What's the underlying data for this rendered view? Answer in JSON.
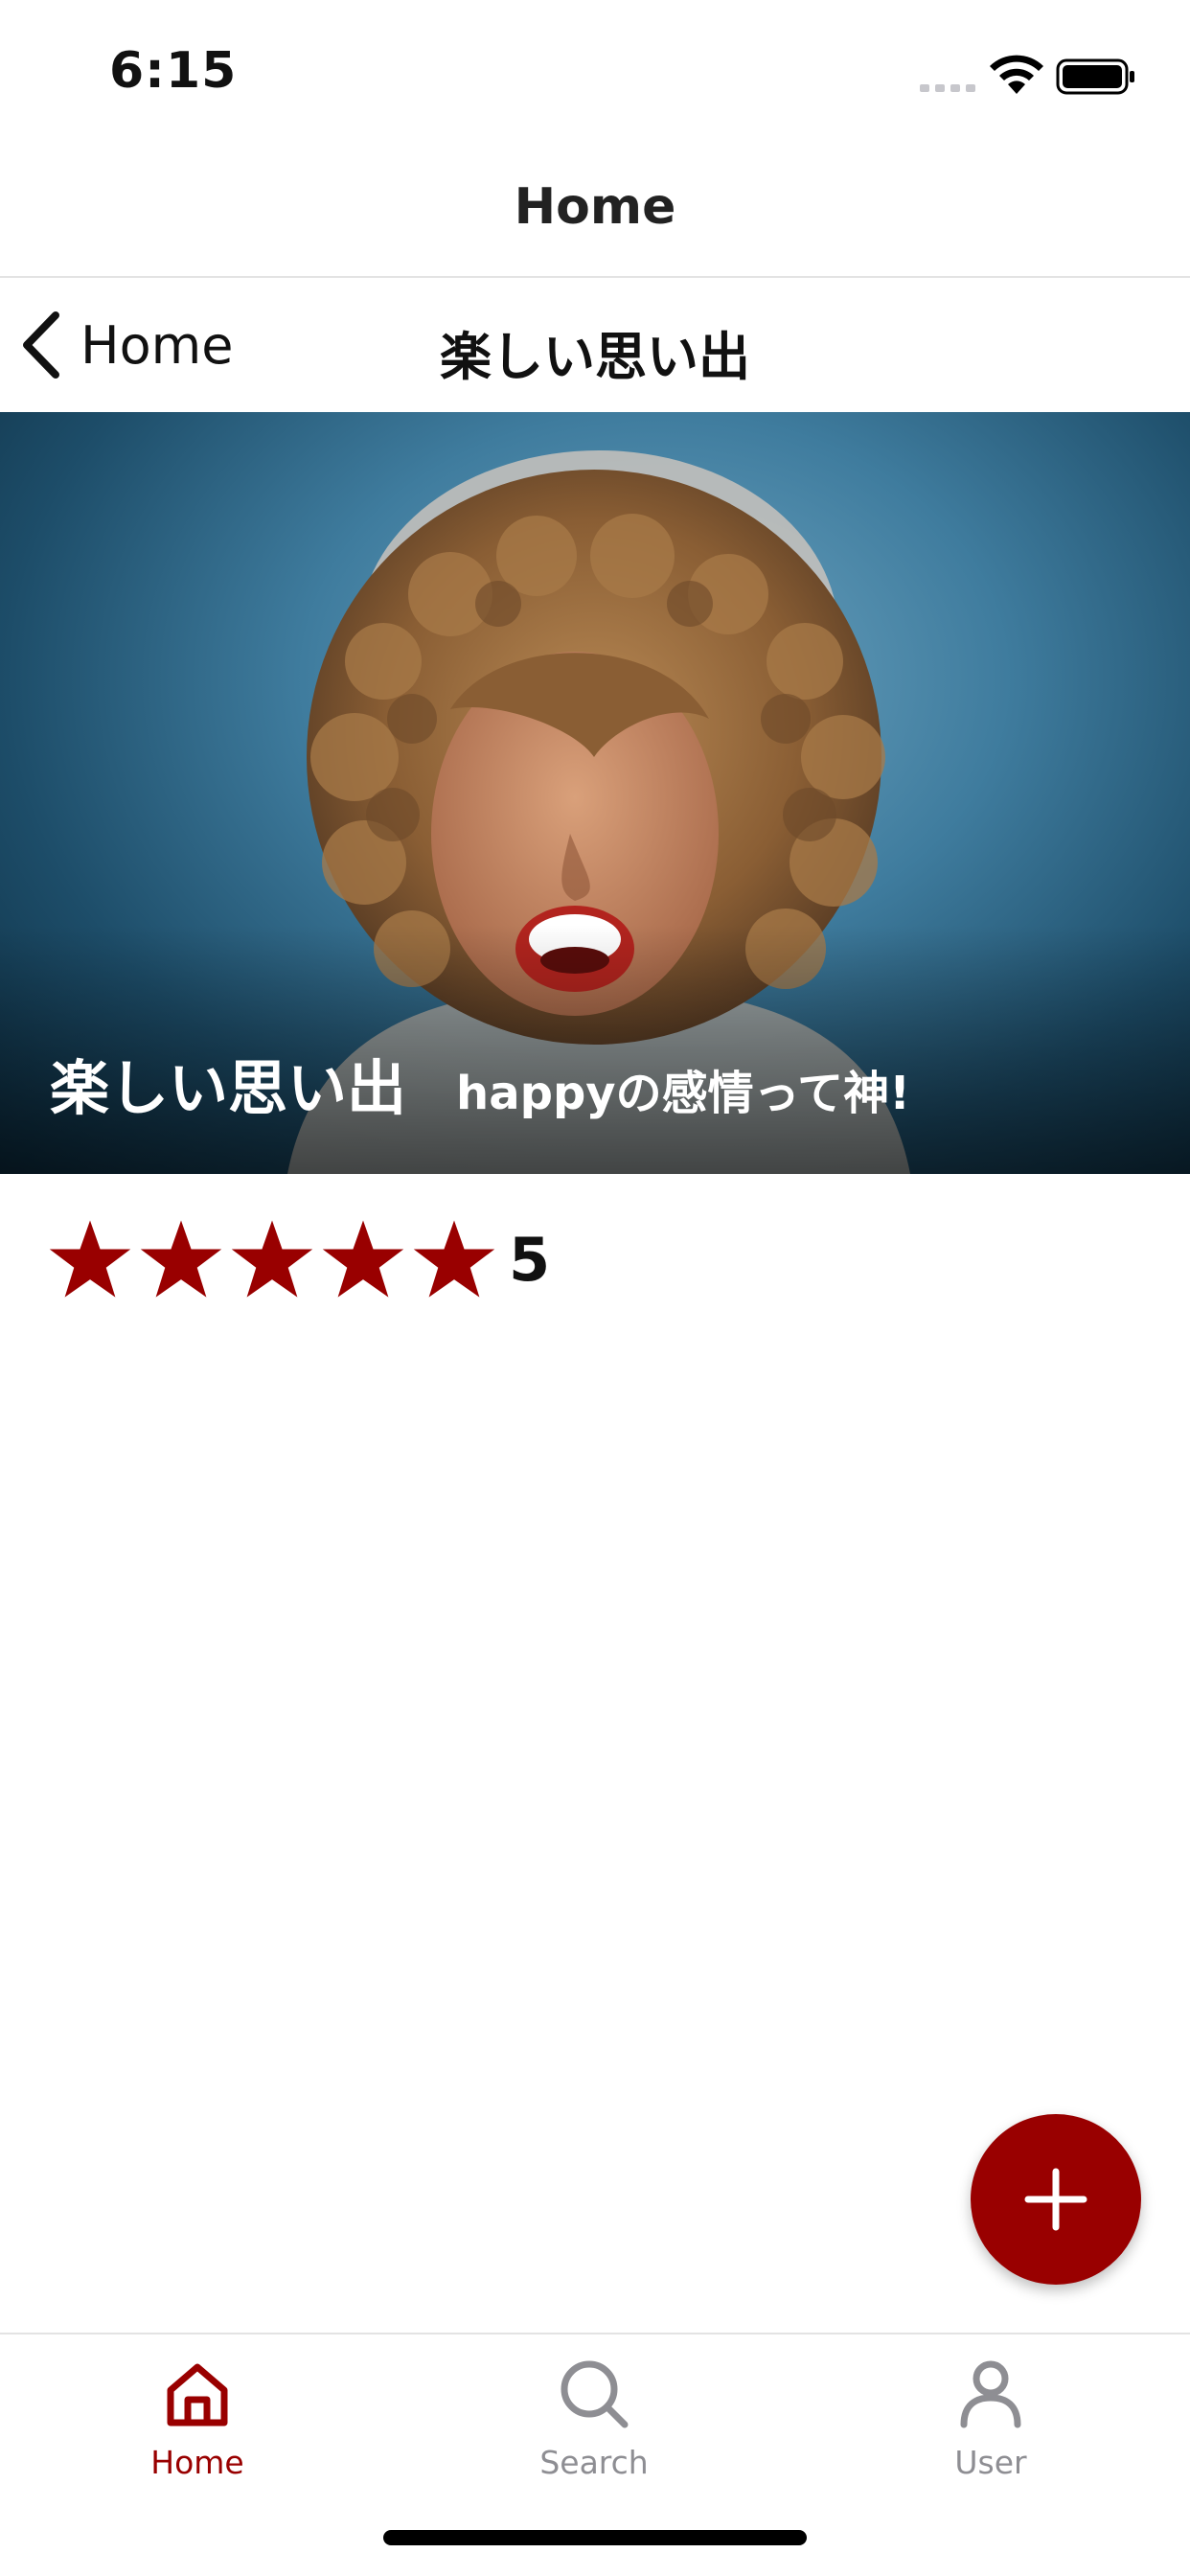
{
  "status_bar": {
    "time": "6:15",
    "icons": [
      "cellular-signal-icon",
      "wifi-icon",
      "battery-icon"
    ]
  },
  "header": {
    "title": "Home"
  },
  "nav": {
    "back_label": "Home",
    "title": "楽しい思い出",
    "back_icon": "chevron-left-icon"
  },
  "memory": {
    "title": "楽しい思い出",
    "caption": "happyの感情って神!",
    "rating": 5,
    "rating_max": 5,
    "rating_label": "5",
    "star_icon": "star-icon"
  },
  "fab": {
    "icon": "plus-icon"
  },
  "tab_bar": {
    "items": [
      {
        "label": "Home",
        "icon": "home-icon",
        "active": true
      },
      {
        "label": "Search",
        "icon": "search-icon",
        "active": false
      },
      {
        "label": "User",
        "icon": "user-icon",
        "active": false
      }
    ]
  },
  "colors": {
    "accent": "#990000",
    "inactive": "#8e8e93",
    "text": "#111111"
  }
}
